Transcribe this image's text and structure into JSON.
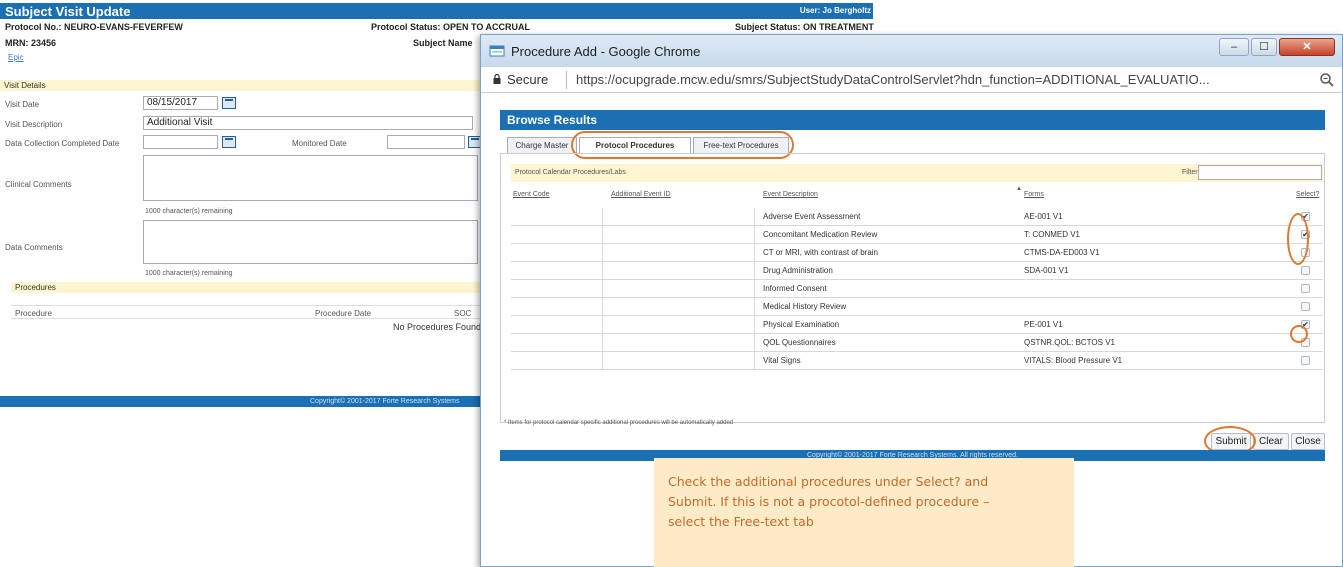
{
  "background_window": {
    "title": "Subject Visit Update",
    "user": "User: Jo Bergholtz",
    "protocol_no": "Protocol No.: NEURO-EVANS-FEVERFEW",
    "protocol_status": "Protocol Status: OPEN TO ACCRUAL",
    "subject_status": "Subject Status: ON TREATMENT",
    "mrn": "MRN: 23456",
    "subject_name": "Subject Name",
    "epic_link": "Epic",
    "visit_details": {
      "section_title": "Visit Details",
      "visit_date_label": "Visit Date",
      "visit_date_value": "08/15/2017",
      "visit_description_label": "Visit Description",
      "visit_description_value": "Additional Visit",
      "data_collection_label": "Data Collection Completed Date",
      "monitored_date_label": "Monitored Date",
      "clinical_comments_label": "Clinical Comments",
      "clinical_remaining": "1000 character(s) remaining",
      "data_comments_label": "Data Comments",
      "data_remaining": "1000 character(s) remaining"
    },
    "procedures": {
      "section_title": "Procedures",
      "col_procedure": "Procedure",
      "col_procedure_date": "Procedure Date",
      "col_soc": "SOC",
      "empty_message": "No Procedures Found"
    },
    "footer": "Copyright© 2001-2017 Forte Research Systems"
  },
  "popup": {
    "window_title": "Procedure Add - Google Chrome",
    "window_buttons": {
      "minimize": "–",
      "maximize": "☐",
      "close": "✕"
    },
    "secure_label": "Secure",
    "url": "https://ocupgrade.mcw.edu/smrs/SubjectStudyDataControlServlet?hdn_function=ADDITIONAL_EVALUATIO...",
    "browse_title": "Browse Results",
    "tabs": [
      "Charge Master",
      "Protocol Procedures",
      "Free-text Procedures"
    ],
    "active_tab": "Protocol Procedures",
    "panel_title": "Protocol Calendar Procedures/Labs",
    "filter_label": "Filter:",
    "columns": {
      "event_code": "Event Code",
      "additional_event_id": "Additional Event ID",
      "event_description": "Event Description",
      "forms": "Forms",
      "select": "Select?"
    },
    "rows": [
      {
        "description": "Adverse Event Assessment",
        "form": "AE-001 V1",
        "checked": true
      },
      {
        "description": "Concomitant Medication Review",
        "form": "T: CONMED V1",
        "checked": true
      },
      {
        "description": "CT or MRI, with contrast of brain",
        "form": "CTMS-DA-ED003 V1",
        "checked": false
      },
      {
        "description": "Drug Administration",
        "form": "SDA-001 V1",
        "checked": false
      },
      {
        "description": "Informed Consent",
        "form": "",
        "checked": false
      },
      {
        "description": "Medical History Review",
        "form": "",
        "checked": false
      },
      {
        "description": "Physical Examination",
        "form": "PE-001 V1",
        "checked": true
      },
      {
        "description": "QOL Questionnaires",
        "form": "QSTNR.QOL: BCTOS V1",
        "checked": false
      },
      {
        "description": "Vital Signs",
        "form": "VITALS: Blood Pressure V1",
        "checked": false
      }
    ],
    "footnote": "* Items for protocol calendar specific additional procedures will be automatically added",
    "buttons": {
      "submit": "Submit",
      "clear": "Clear",
      "close": "Close"
    },
    "footer": "Copyright© 2001-2017 Forte Research Systems. All rights reserved."
  },
  "callout": {
    "line1": "Check the additional procedures under Select? and",
    "line2": "Submit.  If this is not a procotol-defined procedure –",
    "line3": "select the Free-text tab"
  },
  "colors": {
    "header_blue": "#1b6fb3",
    "section_yellow": "#fdf5cf",
    "highlight_orange": "#e0782e",
    "callout_bg": "#fdebc8",
    "callout_text": "#c46a2a"
  }
}
